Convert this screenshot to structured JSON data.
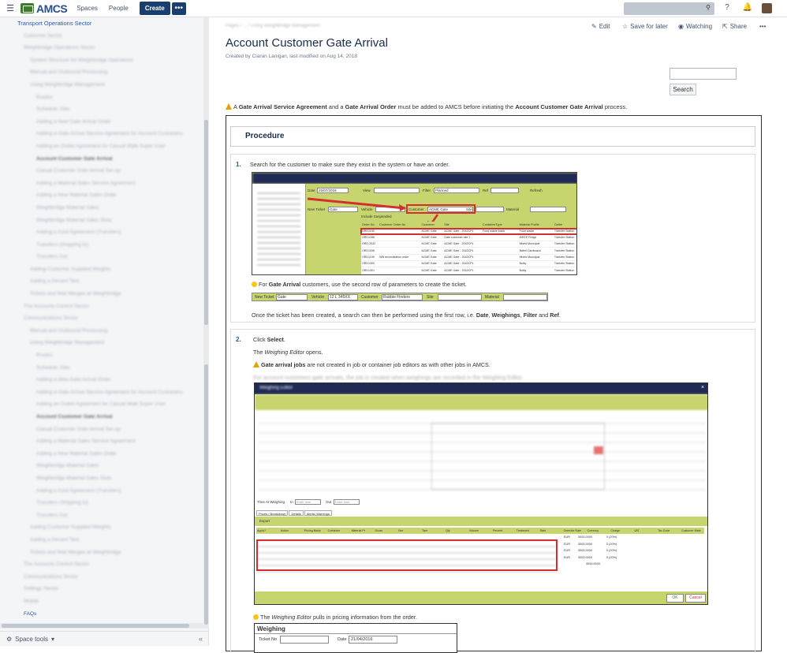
{
  "topbar": {
    "logo": "AMCS",
    "nav": [
      "Spaces",
      "People"
    ],
    "create": "Create",
    "more": "•••"
  },
  "sidebar": {
    "first_item": "Transport Operations Sector",
    "items": [
      "Customer Sector",
      "Weighbridge Operations Sector",
      "System Structure for Weighbridge Operations",
      "Manual and Outbound Processing",
      "Using Weighbridge Management",
      "Routes",
      "Schedule Jobs",
      "Adding a New Gate Arrival Order",
      "Adding a Gate Arrival Service Agreement for Account Customers",
      "Adding an Outlet Agreement for Casual Walk Super User",
      "Account Customer Gate Arrival",
      "Casual Customer Gate Arrival Set up",
      "Adding a Material Sales Service Agreement",
      "Adding a New Material Sales Order",
      "Weighbridge Material Sales",
      "Weighbridge Material Sales Slots",
      "Adding a Cost Agreement (Transfers)",
      "Transfers (Shipping to)",
      "Transfers Out",
      "Adding Customer Supplied Weights",
      "Adding a Decant Tare",
      "Tickets and Mail Merges at Weighbridge",
      "The Accounts Control Sector",
      "Communications Sector",
      "Manual and Outbound Processing",
      "Using Weighbridge Management",
      "Routes",
      "Schedule Jobs",
      "Adding a New Gate Arrival Order",
      "Adding a Gate Arrival Service Agreement for Account Customers",
      "Adding an Outlet Agreement for Casual Walk Super User",
      "Account Customer Gate Arrival",
      "Casual Customer Gate Arrival Set up",
      "Adding a Material Sales Service Agreement",
      "Adding a New Material Sales Order",
      "Weighbridge Material Sales",
      "Weighbridge Material Sales Slots",
      "Adding a Cost Agreement (Transfers)",
      "Transfers (Shipping to)",
      "Transfers Out",
      "Adding Customer Supplied Weights",
      "Adding a Decant Tare",
      "Tickets and Mail Merges at Weighbridge",
      "The Accounts Control Sector",
      "Communications Sector",
      "Settings Sector",
      "Mobile",
      "FAQs"
    ],
    "space_tools": "Space tools"
  },
  "page": {
    "breadcrumb": "Pages / ... / Using Weighbridge Management",
    "actions": {
      "edit": "Edit",
      "save": "Save for later",
      "watch": "Watching",
      "share": "Share",
      "more": "•••"
    },
    "title": "Account Customer Gate Arrival",
    "byline": "Created by Ciaran Lanigan, last modified on Aug 14, 2018",
    "search_button": "Search",
    "warning": {
      "pre": "A ",
      "b1": "Gate Arrival Service Agreement",
      "mid1": " and a ",
      "b2": "Gate Arrival Order",
      "mid2": " must be added to AMCS before initiating the ",
      "b3": "Account Customer Gate Arrival",
      "post": " process."
    },
    "procedure": "Procedure",
    "step1": {
      "num": "1.",
      "text": "Search for the customer to make sure they exist in the system or have an order.",
      "tip_pre": "For ",
      "tip_b": "Gate Arrival",
      "tip_post": " customers, use the second row of parameters to create the ticket.",
      "after_pre": "Once the ticket has been created, a search can then be performed using the first row, i.e. ",
      "after_b1": "Date",
      "after_c1": ", ",
      "after_b2": "Weighings",
      "after_c2": ", ",
      "after_b3": "Filter",
      "after_and": " and ",
      "after_b4": "Ref",
      "after_end": "."
    },
    "step2": {
      "num": "2.",
      "click_pre": "Click ",
      "click_b": "Select",
      "click_end": ".",
      "opens_pre": "The ",
      "opens_i": "Weighing Editor",
      "opens_post": " opens.",
      "warn_b": "Gate arrival jobs",
      "warn_post": " are not created in job or container job editors as with other jobs in AMCS.",
      "blur_line": "For account customers gate arrivals, the job is created when weighings are recorded in the Weighing Editor.",
      "tip_pre": "The ",
      "tip_i": "Weighing Editor",
      "tip_post": " pulls in pricing information from the order."
    }
  },
  "shot1": {
    "labels": {
      "date": "Date",
      "date_val": "25/07/2018",
      "view": "View",
      "filter": "Filter",
      "filter_val": "Planned",
      "ref": "Ref",
      "refresh": "Refresh",
      "new_ticket": "New Ticket",
      "new_ticket_val": "Gate",
      "vehicle": "Vehicle",
      "customer": "Customer",
      "customer_val": "ACME Gate",
      "site": "Site",
      "material": "Material",
      "include_suspended": "Include Suspended"
    },
    "columns": [
      "Order No",
      "Customer Order No",
      "Customer",
      "Site",
      "ContainerType",
      "Material Profile",
      "Outlet"
    ],
    "rows": [
      [
        "ORD1190",
        "",
        "ACME Gate",
        "ACME Gate - 2042CP1",
        "Food waste loads",
        "Food waste",
        "Transfer Station"
      ],
      [
        "ORD1286",
        "",
        "ACME Gate",
        "Gate customer site 2",
        "",
        "WEEE Fridge",
        "Transfer Station"
      ],
      [
        "ORD-2042",
        "",
        "ACME Gate",
        "ACME Gate - 2042CP1",
        "",
        "Mixed Municipal",
        "Transfer Station"
      ],
      [
        "ORD1006",
        "",
        "ACME Gate",
        "ACME Gate - 2042CP1",
        "",
        "Baled Cardboard",
        "Transfer Station"
      ],
      [
        "ORD1199",
        "WB reconciliation order",
        "ACME Gate",
        "ACME Gate - 2042CP1",
        "",
        "Mixed Municipal",
        "Transfer Station"
      ],
      [
        "ORD1300",
        "",
        "ACME Gate",
        "ACME Gate - 2042CP1",
        "",
        "Bulky",
        "Transfer Station"
      ],
      [
        "ORD1301",
        "",
        "ACME Gate",
        "ACME Gate - 2042CP1",
        "",
        "Bulky",
        "Transfer Station"
      ]
    ]
  },
  "shot2": {
    "new_ticket": "New Ticket",
    "new_ticket_val": "Gate",
    "vehicle": "Vehicle",
    "vehicle_val": "12 L 345XX",
    "customer": "Customer",
    "customer_val": "Rubble Finders",
    "site": "Site",
    "material": "Material"
  },
  "shot3": {
    "title": "Weighing Editor",
    "time_at": "Time At Weighing",
    "in": "In",
    "out": "Out",
    "enter_time": "Enter time",
    "tabs": [
      "Prices / Breakdown",
      "Details",
      "Alerts/ Warnings"
    ],
    "export": "Export",
    "columns": [
      "Apply?",
      "Action",
      "Pricing Basis",
      "Container",
      "Material Pr",
      "Gross",
      "Net",
      "Tare",
      "Qty",
      "Volume",
      "Percent",
      "Treatment",
      "Rate",
      "Override Rate",
      "Currency",
      "Charge",
      "VAT",
      "Tax Code",
      "Customer Mate"
    ],
    "currency": "EUR",
    "charge": "3000.0000",
    "vat": "0 (20%)",
    "total": "3000.0000",
    "zero": "0.0000",
    "ok": "OK",
    "cancel": "Cancel"
  },
  "shot4": {
    "title": "Weighing",
    "ticket_no": "Ticket No",
    "date": "Date",
    "date_val": "21/04/2016"
  }
}
